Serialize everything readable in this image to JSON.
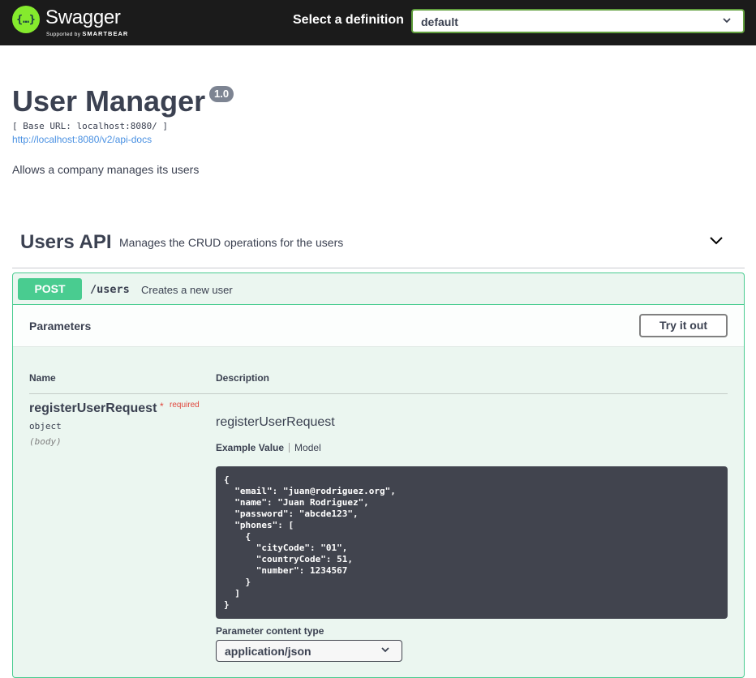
{
  "topbar": {
    "logo_glyph": "{…}",
    "logo_title": "Swagger",
    "logo_sub_prefix": "Supported by",
    "logo_sub_brand": "SMARTBEAR",
    "definition_label": "Select a definition",
    "definition_value": "default",
    "brand_color": "#85ea2d"
  },
  "info": {
    "title": "User Manager",
    "version": "1.0",
    "base_url": "[ Base URL: localhost:8080/ ]",
    "api_docs_link": "http://localhost:8080/v2/api-docs",
    "description": "Allows a company manages its users"
  },
  "tag": {
    "name": "Users API",
    "description": "Manages the CRUD operations for the users",
    "toggle_icon": "chevron-down-icon"
  },
  "operation": {
    "method": "POST",
    "path": "/users",
    "summary": "Creates a new user",
    "method_color": "#49cc90",
    "parameters_title": "Parameters",
    "try_it_out_label": "Try it out",
    "columns": [
      "Name",
      "Description"
    ],
    "parameter": {
      "name": "registerUserRequest",
      "required_star": "*",
      "required_label": "required",
      "type": "object",
      "in": "(body)",
      "schema_name": "registerUserRequest",
      "tab_example": "Example Value",
      "tab_model": "Model",
      "example_value": "{\n  \"email\": \"juan@rodriguez.org\",\n  \"name\": \"Juan Rodriguez\",\n  \"password\": \"abcde123\",\n  \"phones\": [\n    {\n      \"cityCode\": \"01\",\n      \"countryCode\": 51,\n      \"number\": 1234567\n    }\n  ]\n}",
      "content_type_label": "Parameter content type",
      "content_type_value": "application/json"
    }
  }
}
